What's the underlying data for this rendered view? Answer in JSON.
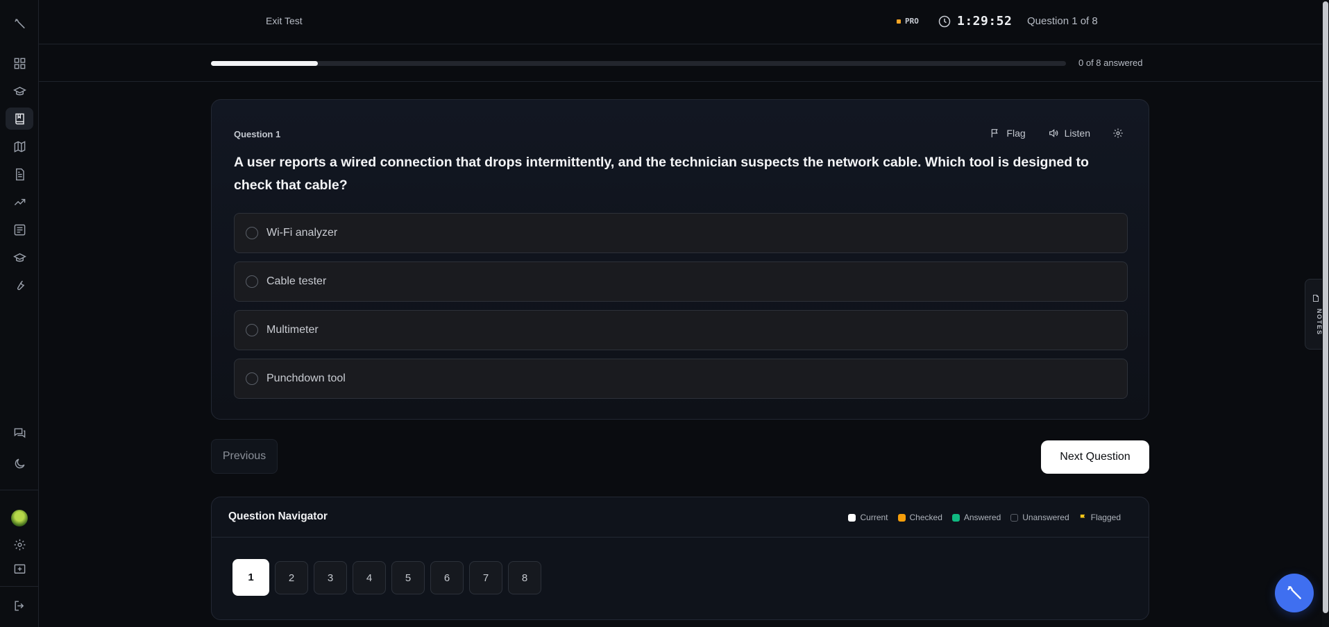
{
  "header": {
    "exit_label": "Exit Test",
    "plan_badge": "PRO",
    "timer": "1:29:52",
    "question_counter": "Question 1 of 8"
  },
  "progress": {
    "answered_label": "0 of 8 answered",
    "fraction": 0.125
  },
  "question": {
    "label": "Question 1",
    "text": "A user reports a wired connection that drops intermittently, and the technician suspects the network cable. Which tool is designed to check that cable?",
    "actions": {
      "flag": "Flag",
      "listen": "Listen"
    },
    "options": [
      "Wi-Fi analyzer",
      "Cable tester",
      "Multimeter",
      "Punchdown tool"
    ]
  },
  "buttons": {
    "previous": "Previous",
    "next": "Next Question"
  },
  "navigator": {
    "title": "Question Navigator",
    "legend": [
      {
        "label": "Current",
        "color": "#ffffff"
      },
      {
        "label": "Checked",
        "color": "#f59e0b"
      },
      {
        "label": "Answered",
        "color": "#10b981"
      },
      {
        "label": "Unanswered",
        "color": "transparent"
      },
      {
        "label": "Flagged",
        "color": "#f5c518"
      }
    ],
    "numbers": [
      "1",
      "2",
      "3",
      "4",
      "5",
      "6",
      "7",
      "8"
    ],
    "current": "1"
  },
  "notes_tab": "NOTES",
  "colors": {
    "accent": "#3f6ff0",
    "pro_dot": "#f5a524",
    "background": "#0a0c10"
  },
  "sidebar": {
    "icons": [
      "logo-icon",
      "dashboard-icon",
      "graduation-cap-icon",
      "book-icon",
      "map-icon",
      "document-icon",
      "trending-icon",
      "list-icon",
      "graduation-cap-icon",
      "wrench-icon",
      "chat-icon",
      "moon-icon",
      "avatar",
      "gear-icon",
      "feedback-icon",
      "logout-icon"
    ]
  }
}
